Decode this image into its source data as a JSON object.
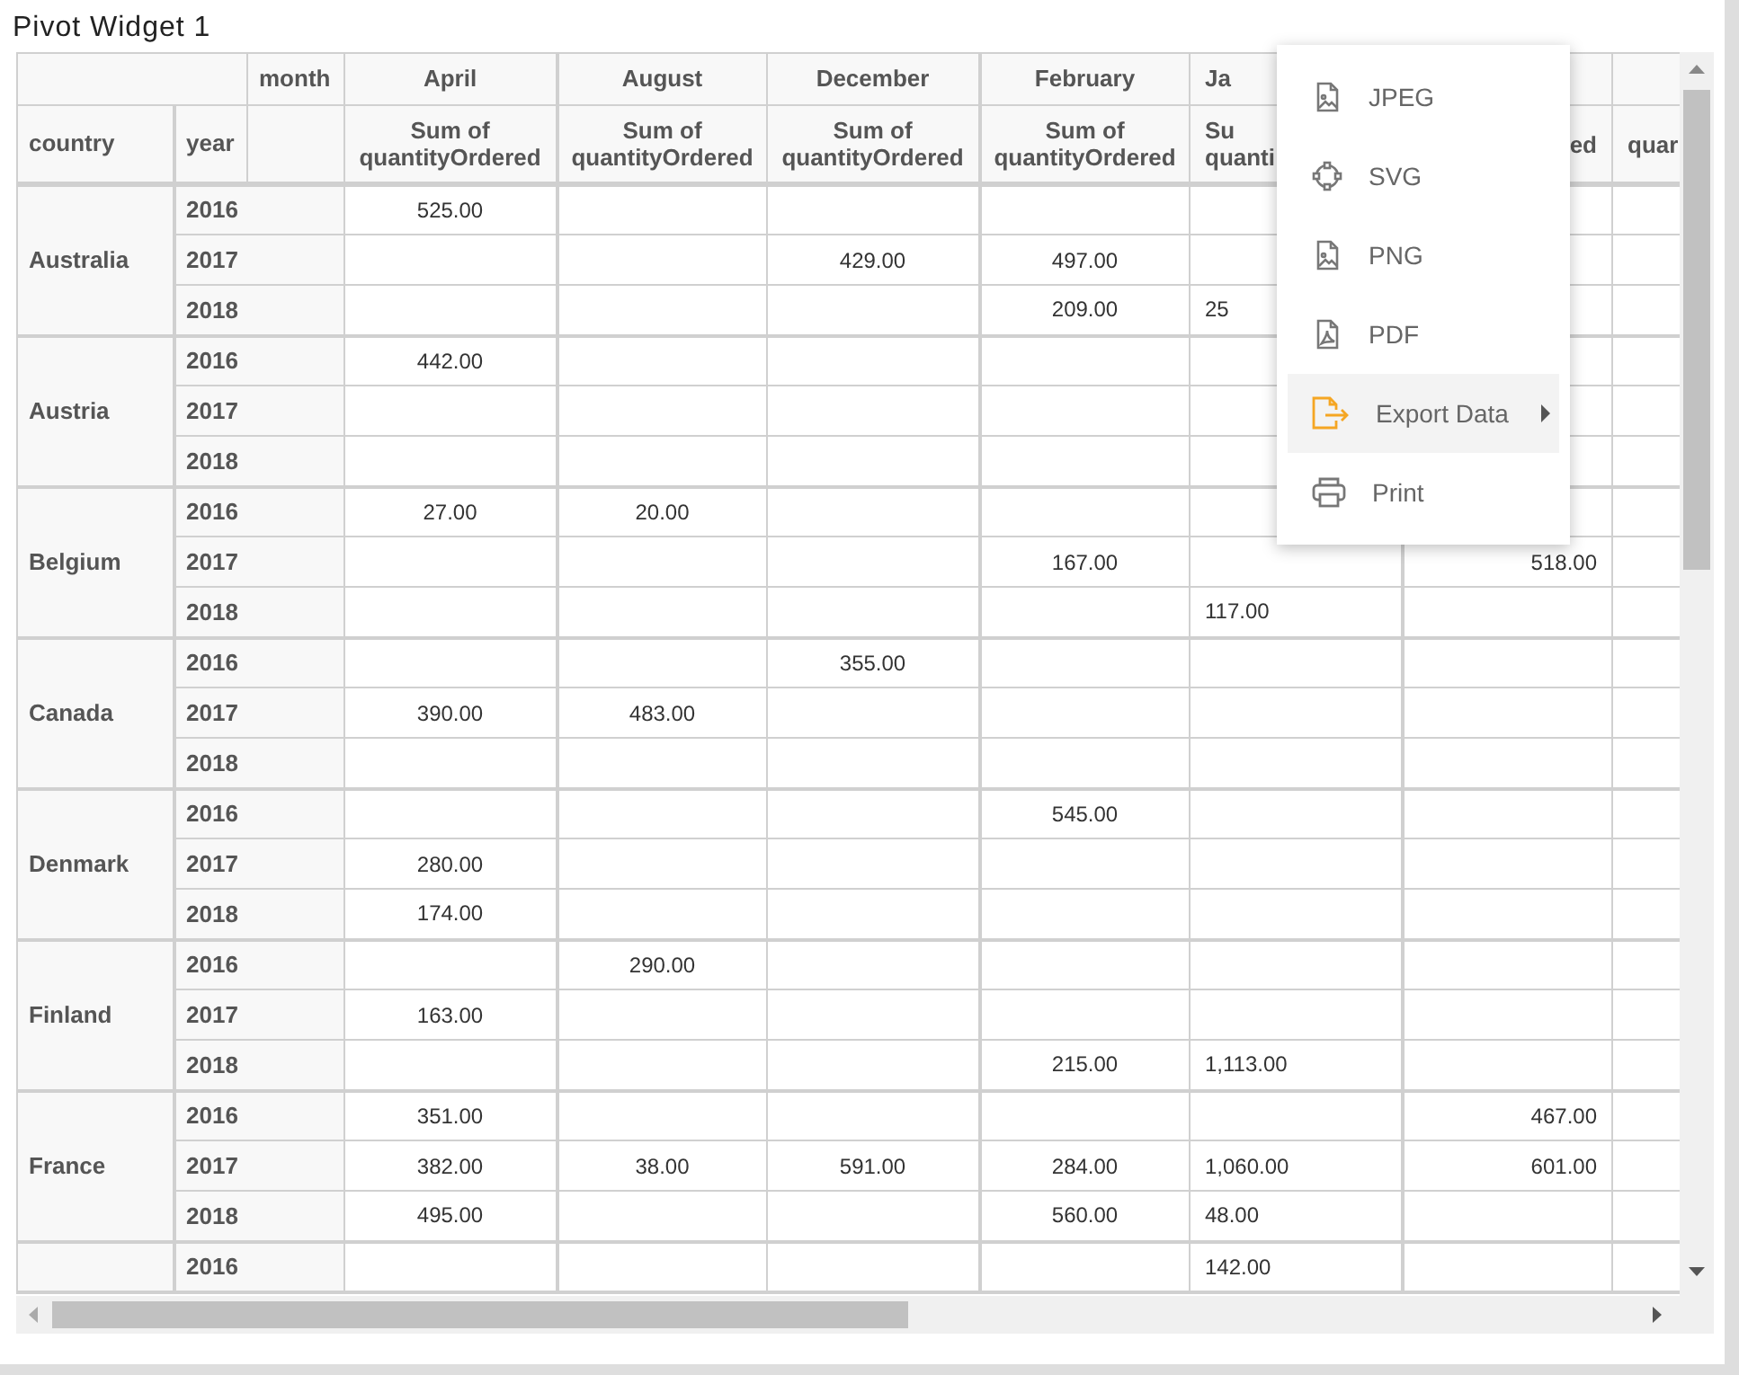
{
  "widget": {
    "title": "Pivot Widget 1"
  },
  "pivot": {
    "column_field": "month",
    "row_fields": [
      "country",
      "year"
    ],
    "columns": [
      {
        "month": "April",
        "measure": [
          "Sum of",
          "quantityOrdered"
        ]
      },
      {
        "month": "August",
        "measure": [
          "Sum of",
          "quantityOrdered"
        ]
      },
      {
        "month": "December",
        "measure": [
          "Sum of",
          "quantityOrdered"
        ]
      },
      {
        "month": "February",
        "measure": [
          "Sum of",
          "quantityOrdered"
        ]
      },
      {
        "month": "Ja",
        "measure": [
          "Su",
          "quanti"
        ]
      },
      {
        "measure": [
          "ed"
        ]
      },
      {
        "measure": [
          "quar"
        ]
      }
    ],
    "groups": [
      {
        "country": "Australia",
        "rows": [
          {
            "year": "2016",
            "cells": [
              "525.00",
              null,
              null,
              null,
              null,
              null,
              null
            ]
          },
          {
            "year": "2017",
            "cells": [
              null,
              null,
              "429.00",
              "497.00",
              null,
              null,
              null
            ]
          },
          {
            "year": "2018",
            "cells": [
              null,
              null,
              null,
              "209.00",
              "25",
              null,
              null
            ]
          }
        ]
      },
      {
        "country": "Austria",
        "rows": [
          {
            "year": "2016",
            "cells": [
              "442.00",
              null,
              null,
              null,
              null,
              null,
              null
            ]
          },
          {
            "year": "2017",
            "cells": [
              null,
              null,
              null,
              null,
              null,
              null,
              null
            ]
          },
          {
            "year": "2018",
            "cells": [
              null,
              null,
              null,
              null,
              null,
              null,
              null
            ]
          }
        ]
      },
      {
        "country": "Belgium",
        "rows": [
          {
            "year": "2016",
            "cells": [
              "27.00",
              "20.00",
              null,
              null,
              null,
              null,
              null
            ]
          },
          {
            "year": "2017",
            "cells": [
              null,
              null,
              null,
              "167.00",
              null,
              "518.00",
              null
            ]
          },
          {
            "year": "2018",
            "cells": [
              null,
              null,
              null,
              null,
              "117.00",
              null,
              null
            ]
          }
        ]
      },
      {
        "country": "Canada",
        "rows": [
          {
            "year": "2016",
            "cells": [
              null,
              null,
              "355.00",
              null,
              null,
              null,
              null
            ]
          },
          {
            "year": "2017",
            "cells": [
              "390.00",
              "483.00",
              null,
              null,
              null,
              null,
              null
            ]
          },
          {
            "year": "2018",
            "cells": [
              null,
              null,
              null,
              null,
              null,
              null,
              null
            ]
          }
        ]
      },
      {
        "country": "Denmark",
        "rows": [
          {
            "year": "2016",
            "cells": [
              null,
              null,
              null,
              "545.00",
              null,
              null,
              null
            ]
          },
          {
            "year": "2017",
            "cells": [
              "280.00",
              null,
              null,
              null,
              null,
              null,
              null
            ]
          },
          {
            "year": "2018",
            "cells": [
              "174.00",
              null,
              null,
              null,
              null,
              null,
              null
            ]
          }
        ]
      },
      {
        "country": "Finland",
        "rows": [
          {
            "year": "2016",
            "cells": [
              null,
              "290.00",
              null,
              null,
              null,
              null,
              null
            ]
          },
          {
            "year": "2017",
            "cells": [
              "163.00",
              null,
              null,
              null,
              null,
              null,
              null
            ]
          },
          {
            "year": "2018",
            "cells": [
              null,
              null,
              null,
              "215.00",
              "1,113.00",
              null,
              null
            ]
          }
        ]
      },
      {
        "country": "France",
        "rows": [
          {
            "year": "2016",
            "cells": [
              "351.00",
              null,
              null,
              null,
              null,
              "467.00",
              null
            ]
          },
          {
            "year": "2017",
            "cells": [
              "382.00",
              "38.00",
              "591.00",
              "284.00",
              "1,060.00",
              "601.00",
              null
            ]
          },
          {
            "year": "2018",
            "cells": [
              "495.00",
              null,
              null,
              "560.00",
              "48.00",
              null,
              null
            ]
          }
        ]
      },
      {
        "rows": [
          {
            "year": "2016",
            "cells": [
              null,
              null,
              null,
              null,
              "142.00",
              null,
              null
            ]
          }
        ]
      }
    ]
  },
  "export_menu": {
    "items": [
      {
        "label": "JPEG",
        "kind": "image",
        "selected": false,
        "has_submenu": false
      },
      {
        "label": "SVG",
        "kind": "vector",
        "selected": false,
        "has_submenu": false
      },
      {
        "label": "PNG",
        "kind": "image",
        "selected": false,
        "has_submenu": false
      },
      {
        "label": "PDF",
        "kind": "pdf",
        "selected": false,
        "has_submenu": false
      },
      {
        "label": "Export Data",
        "kind": "export",
        "selected": true,
        "has_submenu": true
      },
      {
        "label": "Print",
        "kind": "print",
        "selected": false,
        "has_submenu": false
      }
    ]
  }
}
